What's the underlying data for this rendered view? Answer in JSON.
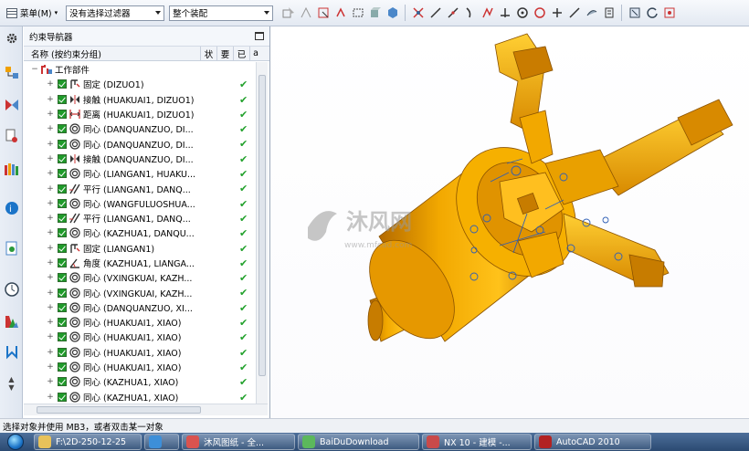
{
  "toolbar": {
    "menu_label": "菜单(M)",
    "filter_combo": "没有选择过滤器",
    "scope_combo": "整个装配"
  },
  "navigator": {
    "title": "约束导航器",
    "columns": {
      "name": "名称 (按约束分组)",
      "status": "状",
      "required": "要",
      "done": "已",
      "extra": "a"
    },
    "root_label": "工作部件",
    "rows": [
      {
        "icon": "fix",
        "label": "固定 (DIZUO1)"
      },
      {
        "icon": "touch",
        "label": "接触 (HUAKUAI1, DIZUO1)"
      },
      {
        "icon": "distance",
        "label": "距离 (HUAKUAI1, DIZUO1)"
      },
      {
        "icon": "concentric",
        "label": "同心 (DANQUANZUO, DI..."
      },
      {
        "icon": "concentric",
        "label": "同心 (DANQUANZUO, DI..."
      },
      {
        "icon": "touch",
        "label": "接触 (DANQUANZUO, DI..."
      },
      {
        "icon": "concentric",
        "label": "同心 (LIANGAN1, HUAKU..."
      },
      {
        "icon": "parallel",
        "label": "平行 (LIANGAN1, DANQ..."
      },
      {
        "icon": "concentric",
        "label": "同心 (WANGFULUOSHUA..."
      },
      {
        "icon": "parallel",
        "label": "平行 (LIANGAN1, DANQ..."
      },
      {
        "icon": "concentric",
        "label": "同心 (KAZHUA1, DANQU..."
      },
      {
        "icon": "fix",
        "label": "固定 (LIANGAN1)"
      },
      {
        "icon": "angle",
        "label": "角度 (KAZHUA1, LIANGA..."
      },
      {
        "icon": "concentric",
        "label": "同心 (VXINGKUAI, KAZH..."
      },
      {
        "icon": "concentric",
        "label": "同心 (VXINGKUAI, KAZH..."
      },
      {
        "icon": "concentric",
        "label": "同心 (DANQUANZUO, XI..."
      },
      {
        "icon": "concentric",
        "label": "同心 (HUAKUAI1, XIAO)"
      },
      {
        "icon": "concentric",
        "label": "同心 (HUAKUAI1, XIAO)"
      },
      {
        "icon": "concentric",
        "label": "同心 (HUAKUAI1, XIAO)"
      },
      {
        "icon": "concentric",
        "label": "同心 (HUAKUAI1, XIAO)"
      },
      {
        "icon": "concentric",
        "label": "同心 (KAZHUA1, XIAO)"
      },
      {
        "icon": "concentric",
        "label": "同心 (KAZHUA1, XIAO)"
      }
    ]
  },
  "viewport": {
    "watermark_text": "沐风网",
    "watermark_url": "www.mfcad.com"
  },
  "status_text": "选择对象并使用 MB3，或者双击某一对象",
  "taskbar": {
    "items": [
      {
        "label": "F:\\2D-250-12-25",
        "color": "#e8c25a"
      },
      {
        "label": "",
        "color": "#3d8fd9"
      },
      {
        "label": "沐风图纸 - 全...",
        "color": "#d9534f"
      },
      {
        "label": "BaiDuDownload",
        "color": "#5cb85c"
      },
      {
        "label": "NX 10 - 建模 -...",
        "color": "#c94a4a"
      },
      {
        "label": "AutoCAD 2010",
        "color": "#b22222"
      }
    ]
  },
  "colors": {
    "model": "#f0a000",
    "check": "#22a12c",
    "accent": "#1b74c8"
  }
}
